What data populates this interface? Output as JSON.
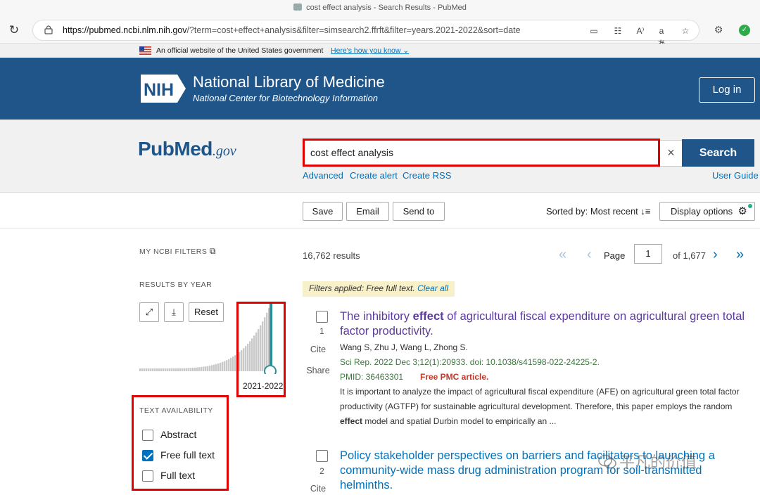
{
  "browser": {
    "tab_title": "cost effect analysis - Search Results - PubMed",
    "url_host": "https://pubmed.ncbi.nlm.nih.gov",
    "url_rest": "/?term=cost+effect+analysis&filter=simsearch2.ffrft&filter=years.2021-2022&sort=date",
    "icons": [
      "reload-icon",
      "lock-icon",
      "reader-icon",
      "qr-icon",
      "read-aloud-icon",
      "translate-icon",
      "favorite-icon",
      "extension-icon",
      "shield-check-icon"
    ]
  },
  "gov_banner": {
    "text": "An official website of the United States government",
    "link": "Here's how you know"
  },
  "nih": {
    "logo": "NIH",
    "title": "National Library of Medicine",
    "subtitle": "National Center for Biotechnology Information",
    "login": "Log in"
  },
  "search": {
    "logo_pub": "Pub",
    "logo_med": "Med",
    "logo_gov": ".gov",
    "query": "cost effect analysis",
    "clear": "×",
    "button": "Search",
    "advanced": "Advanced",
    "create_alert": "Create alert",
    "create_rss": "Create RSS",
    "user_guide": "User Guide"
  },
  "toolbar": {
    "save": "Save",
    "email": "Email",
    "send_to": "Send to",
    "sorted_by": "Sorted by: Most recent",
    "display_options": "Display options"
  },
  "sidebar": {
    "my_ncbi_filters": "MY NCBI FILTERS",
    "results_by_year": "RESULTS BY YEAR",
    "reset": "Reset",
    "year_range": "2021-2022",
    "text_availability": "TEXT AVAILABILITY",
    "filters": [
      {
        "label": "Abstract",
        "checked": false
      },
      {
        "label": "Free full text",
        "checked": true
      },
      {
        "label": "Full text",
        "checked": false
      }
    ]
  },
  "results": {
    "count": "16,762 results",
    "page_label": "Page",
    "page": "1",
    "of_pages": "of 1,677",
    "filters_applied": "Filters applied: Free full text.",
    "clear_all": "Clear all",
    "cite": "Cite",
    "share": "Share",
    "items": [
      {
        "num": "1",
        "title_pre": "The inhibitory ",
        "title_bold": "effect",
        "title_post": " of agricultural fiscal expenditure on agricultural green total factor productivity.",
        "authors": "Wang S, Zhu J, Wang L, Zhong S.",
        "citation": "Sci Rep. 2022 Dec 3;12(1):20933. doi: 10.1038/s41598-022-24225-2.",
        "pmid": "PMID: 36463301",
        "free": "Free PMC article.",
        "snippet_pre": "It is important to analyze the impact of agricultural fiscal expenditure (AFE) on agricultural green total factor productivity (AGTFP) for sustainable agricultural development. Therefore, this paper employs the random ",
        "snippet_bold": "effect",
        "snippet_post": " model and spatial Durbin model to empirically an ..."
      },
      {
        "num": "2",
        "title": "Policy stakeholder perspectives on barriers and facilitators to launching a community-wide mass drug administration program for soil-transmitted helminths."
      }
    ]
  },
  "watermark": "平凡的价值",
  "colors": {
    "nih_blue": "#20558a",
    "link_blue": "#0071bc",
    "highlight_red": "#e00000",
    "visited_purple": "#5c3a9e",
    "histogram_teal": "#2a8f97"
  }
}
